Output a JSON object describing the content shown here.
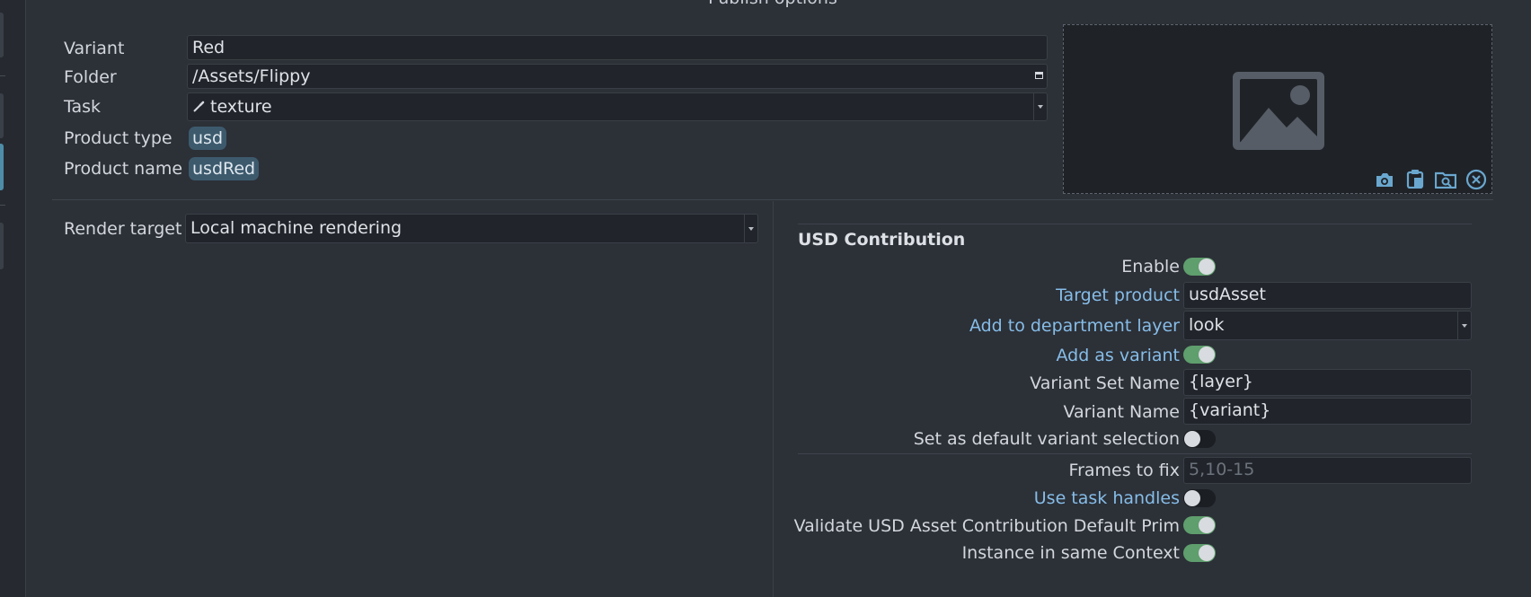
{
  "header": {
    "title": "Publish options"
  },
  "context": {
    "variant_label": "Variant",
    "variant_value": "Red",
    "folder_label": "Folder",
    "folder_value": "/Assets/Flippy",
    "task_label": "Task",
    "task_value": "texture",
    "task_icon": "brush-icon",
    "product_type_label": "Product type",
    "product_type_value": "usd",
    "product_name_label": "Product name",
    "product_name_value": "usdRed"
  },
  "thumbnail": {
    "placeholder_icon": "image-placeholder-icon",
    "tools": [
      "camera-icon",
      "paste-icon",
      "browse-folder-icon",
      "clear-icon"
    ]
  },
  "render": {
    "label": "Render target",
    "value": "Local machine rendering"
  },
  "usd": {
    "title": "USD Contribution",
    "enable_label": "Enable",
    "enable_on": true,
    "target_product_label": "Target product",
    "target_product_value": "usdAsset",
    "department_layer_label": "Add to department layer",
    "department_layer_value": "look",
    "add_as_variant_label": "Add as variant",
    "add_as_variant_on": true,
    "variant_set_name_label": "Variant Set Name",
    "variant_set_name_value": "{layer}",
    "variant_name_label": "Variant Name",
    "variant_name_value": "{variant}",
    "default_variant_label": "Set as default variant selection",
    "default_variant_on": false
  },
  "frames": {
    "label": "Frames to fix",
    "placeholder": "5,10-15"
  },
  "options": {
    "use_task_handles_label": "Use task handles",
    "use_task_handles_on": false,
    "validate_default_prim_label": "Validate USD Asset Contribution Default Prim",
    "validate_default_prim_on": true,
    "instance_context_label": "Instance in same Context",
    "instance_context_on": true
  },
  "colors": {
    "background": "#2c3037",
    "field": "#21252b",
    "accent_blue_label": "#86bde8",
    "toggle_on": "#5f9e6d",
    "tag": "#3d5a6d"
  }
}
